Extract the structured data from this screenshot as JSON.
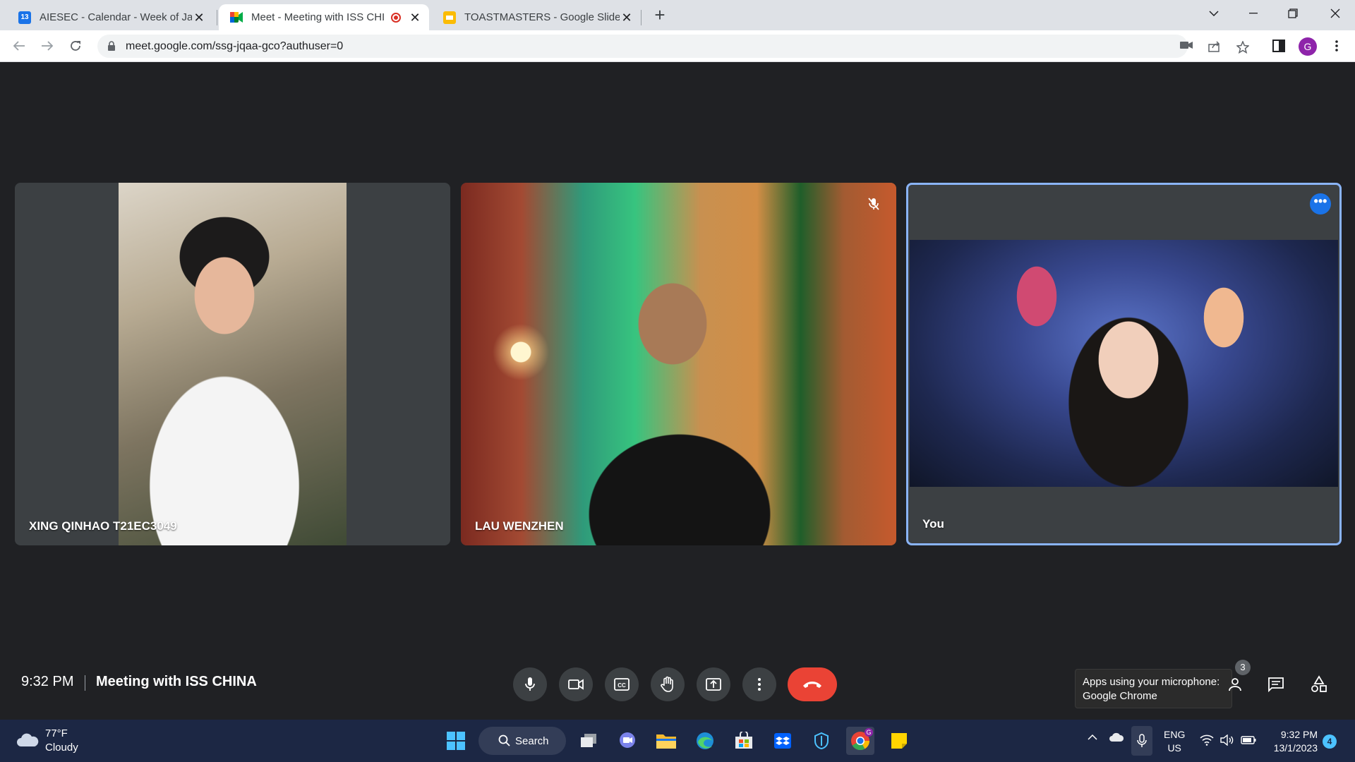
{
  "browser": {
    "tabs": [
      {
        "title": "AIESEC - Calendar - Week of Janu",
        "favicon": "calendar-icon",
        "fav_label": "13",
        "color": "#1a73e8"
      },
      {
        "title": "Meet - Meeting with ISS CHI",
        "favicon": "meet-icon",
        "color": "#00897b",
        "active": true,
        "recording": true
      },
      {
        "title": "TOASTMASTERS - Google Slides",
        "favicon": "slides-icon",
        "color": "#fbbc04"
      }
    ],
    "url": "meet.google.com/ssg-jqaa-gco?authuser=0",
    "profile_initial": "G"
  },
  "meet": {
    "participants": [
      {
        "name": "XING QINHAO T21EC3049"
      },
      {
        "name": "LAU WENZHEN",
        "muted": true
      },
      {
        "name": "You",
        "active_speaker": true
      }
    ],
    "time": "9:32 PM",
    "meeting_title": "Meeting with ISS CHINA",
    "people_count": "3",
    "tooltip": {
      "line1": "Apps using your microphone:",
      "line2": "Google Chrome"
    }
  },
  "taskbar": {
    "weather": {
      "temp": "77°F",
      "condition": "Cloudy"
    },
    "search_label": "Search",
    "lang_line1": "ENG",
    "lang_line2": "US",
    "time": "9:32 PM",
    "date": "13/1/2023",
    "notifications": "4",
    "chrome_badge": "G"
  },
  "colors": {
    "meet_bg": "#202124",
    "hangup": "#ea4335",
    "active_border": "#8ab4f8",
    "taskbar": "#1c2744"
  }
}
